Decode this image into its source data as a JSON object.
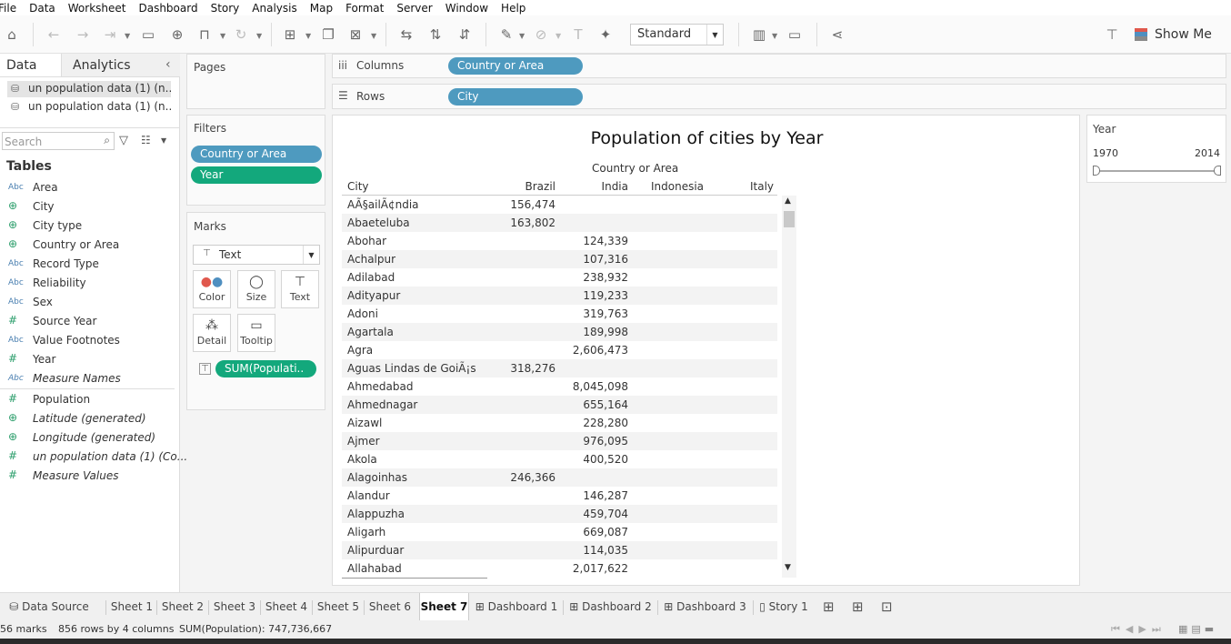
{
  "menu": [
    "File",
    "Data",
    "Worksheet",
    "Dashboard",
    "Story",
    "Analysis",
    "Map",
    "Format",
    "Server",
    "Window",
    "Help"
  ],
  "toolbar": {
    "fit_mode": "Standard",
    "show_me": "Show Me"
  },
  "left": {
    "tab_data": "Data",
    "tab_analytics": "Analytics",
    "datasources": [
      "un population data (1) (n...",
      "un population data (1) (n..."
    ],
    "search_placeholder": "Search",
    "tables_heading": "Tables",
    "dimensions": [
      {
        "type": "Abc",
        "name": "Area"
      },
      {
        "type": "globe",
        "name": "City"
      },
      {
        "type": "globe",
        "name": "City type"
      },
      {
        "type": "globe",
        "name": "Country or Area"
      },
      {
        "type": "Abc",
        "name": "Record Type"
      },
      {
        "type": "Abc",
        "name": "Reliability"
      },
      {
        "type": "Abc",
        "name": "Sex"
      },
      {
        "type": "#",
        "name": "Source Year"
      },
      {
        "type": "Abc",
        "name": "Value Footnotes"
      },
      {
        "type": "#",
        "name": "Year"
      },
      {
        "type": "Abc",
        "name": "Measure Names",
        "italic": true
      }
    ],
    "measures": [
      {
        "type": "#",
        "name": "Population"
      },
      {
        "type": "globe",
        "name": "Latitude (generated)",
        "italic": true
      },
      {
        "type": "globe",
        "name": "Longitude (generated)",
        "italic": true
      },
      {
        "type": "#",
        "name": "un population data (1) (Co...",
        "italic": true
      },
      {
        "type": "#",
        "name": "Measure Values",
        "italic": true
      }
    ]
  },
  "shelves": {
    "pages": "Pages",
    "columns_label": "Columns",
    "columns_pill": "Country or Area",
    "rows_label": "Rows",
    "rows_pill": "City",
    "filters": "Filters",
    "filter_pills": [
      "Country or Area",
      "Year"
    ],
    "marks": "Marks",
    "mark_type": "Text",
    "mark_buttons": [
      "Color",
      "Size",
      "Text",
      "Detail",
      "Tooltip"
    ],
    "mark_pill": "SUM(Populati.."
  },
  "viz": {
    "title": "Population of cities by Year",
    "column_header": "Country or Area",
    "headers": [
      "City",
      "Brazil",
      "India",
      "Indonesia",
      "Italy"
    ],
    "rows": [
      {
        "city": "AÃ§ailÃ¢ndia",
        "brazil": "156,474",
        "india": ""
      },
      {
        "city": "Abaeteluba",
        "brazil": "163,802",
        "india": ""
      },
      {
        "city": "Abohar",
        "brazil": "",
        "india": "124,339"
      },
      {
        "city": "Achalpur",
        "brazil": "",
        "india": "107,316"
      },
      {
        "city": "Adilabad",
        "brazil": "",
        "india": "238,932"
      },
      {
        "city": "Adityapur",
        "brazil": "",
        "india": "119,233"
      },
      {
        "city": "Adoni",
        "brazil": "",
        "india": "319,763"
      },
      {
        "city": "Agartala",
        "brazil": "",
        "india": "189,998"
      },
      {
        "city": "Agra",
        "brazil": "",
        "india": "2,606,473"
      },
      {
        "city": "Aguas Lindas de GoiÃ¡s",
        "brazil": "318,276",
        "india": ""
      },
      {
        "city": "Ahmedabad",
        "brazil": "",
        "india": "8,045,098"
      },
      {
        "city": "Ahmednagar",
        "brazil": "",
        "india": "655,164"
      },
      {
        "city": "Aizawl",
        "brazil": "",
        "india": "228,280"
      },
      {
        "city": "Ajmer",
        "brazil": "",
        "india": "976,095"
      },
      {
        "city": "Akola",
        "brazil": "",
        "india": "400,520"
      },
      {
        "city": "Alagoinhas",
        "brazil": "246,366",
        "india": ""
      },
      {
        "city": "Alandur",
        "brazil": "",
        "india": "146,287"
      },
      {
        "city": "Alappuzha",
        "brazil": "",
        "india": "459,704"
      },
      {
        "city": "Aligarh",
        "brazil": "",
        "india": "669,087"
      },
      {
        "city": "Alipurduar",
        "brazil": "",
        "india": "114,035"
      },
      {
        "city": "Allahabad",
        "brazil": "",
        "india": "2,017,622"
      }
    ]
  },
  "year_filter": {
    "label": "Year",
    "min": "1970",
    "max": "2014"
  },
  "sheet_tabs": [
    "Data Source",
    "Sheet 1",
    "Sheet 2",
    "Sheet 3",
    "Sheet 4",
    "Sheet 5",
    "Sheet 6",
    "Sheet 7",
    "Dashboard 1",
    "Dashboard 2",
    "Dashboard 3",
    "Story 1"
  ],
  "active_tab": "Sheet 7",
  "status": {
    "marks": "56 marks",
    "rows": "856 rows by 4 columns",
    "sum": "SUM(Population): 747,736,667"
  }
}
